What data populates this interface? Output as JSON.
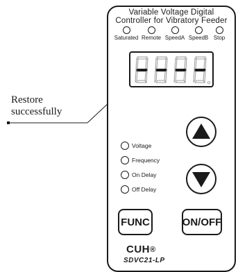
{
  "callout": {
    "line1": "Restore",
    "line2": "successfully"
  },
  "panel": {
    "title_line1": "Variable Voltage Digital",
    "title_line2": "Controller for Vibratory Feeder",
    "indicators": [
      "Saturated",
      "Remote",
      "SpeedA",
      "SpeedB",
      "Stop"
    ],
    "display": {
      "digits": [
        "-",
        "-",
        "-",
        "-"
      ]
    },
    "side_indicators": [
      "Voltage",
      "Frequency",
      "On Delay",
      "Off Delay"
    ],
    "buttons": {
      "up": "up",
      "down": "down",
      "func": "FUNC",
      "onoff": "ON/OFF"
    },
    "brand": "CUH",
    "brand_mark": "®",
    "model": "SDVC21-LP"
  }
}
